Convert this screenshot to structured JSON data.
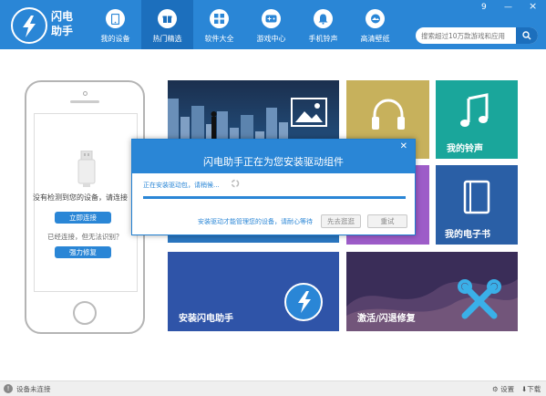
{
  "app": {
    "logo_text": "闪电\n助手"
  },
  "window": {
    "menu_label": "9",
    "minimize_label": "—",
    "close_label": "×"
  },
  "nav": [
    {
      "label": "我的设备",
      "icon": "phone-icon",
      "active": false
    },
    {
      "label": "热门精选",
      "icon": "gift-icon",
      "active": true
    },
    {
      "label": "软件大全",
      "icon": "grid-icon",
      "active": false
    },
    {
      "label": "游戏中心",
      "icon": "gamepad-icon",
      "active": false
    },
    {
      "label": "手机铃声",
      "icon": "bell-icon",
      "active": false
    },
    {
      "label": "高清壁纸",
      "icon": "wallpaper-icon",
      "active": false
    }
  ],
  "search": {
    "placeholder": "搜索超过10万款游戏和应用"
  },
  "device": {
    "no_device_text": "没有检测到您的设备，请连接",
    "connect_button": "立即连接",
    "connected_hint": "已经连接，但无法识别？",
    "force_fix_button": "强力修复"
  },
  "tiles": {
    "ringtone": "我的铃声",
    "ebook": "我的电子书",
    "install": "安装闪电助手",
    "repair": "激活/闪退修复"
  },
  "dialog": {
    "title": "闪电助手正在为您安装驱动组件",
    "progress_text": "正在安装驱动包，请稍候...",
    "footer_text": "安装驱动才能管理您的设备，请耐心等待",
    "skip_button": "先去逛逛",
    "retry_button": "重试",
    "progress": 1.0
  },
  "status": {
    "device_status": "设备未连接",
    "settings_label": "设置",
    "download_label": "下载"
  },
  "colors": {
    "brand": "#2a86d6",
    "brand_dark": "#1c6fbd"
  }
}
